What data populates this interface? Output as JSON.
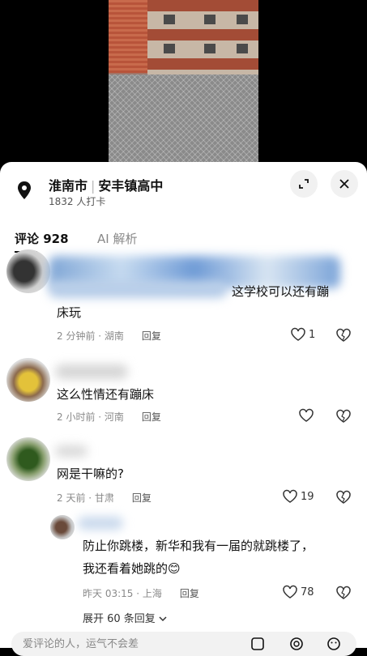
{
  "location": {
    "city": "淮南市",
    "place": "安丰镇高中",
    "checkins": "1832 人打卡"
  },
  "tabs": [
    {
      "label": "评论 928",
      "active": true
    },
    {
      "label": "AI 解析",
      "active": false
    }
  ],
  "comments": [
    {
      "text_line1": "这学校可以还有蹦",
      "text_line2": "床玩",
      "time_region": "2 分钟前 · 湖南",
      "reply_label": "回复",
      "likes": "1"
    },
    {
      "text_line1": "这么性情还有蹦床",
      "time_region": "2 小时前 · 河南",
      "reply_label": "回复",
      "likes": ""
    },
    {
      "text_line1": "网是干嘛的?",
      "time_region": "2 天前 · 甘肃",
      "reply_label": "回复",
      "likes": "19"
    }
  ],
  "reply": {
    "text_line1": "防止你跳楼，新华和我有一届的就跳楼了，",
    "text_line2": "我还看着她跳的",
    "emoji": "😊",
    "time_region": "昨天 03:15 · 上海",
    "reply_label": "回复",
    "likes": "78",
    "expand_label": "展开 60 条回复"
  },
  "input": {
    "placeholder": "爱评论的人，运气不会差"
  },
  "icons": [
    "location-icon",
    "expand-icon",
    "close-icon",
    "heart-icon",
    "broken-heart-icon",
    "chevron-down-icon",
    "image-icon",
    "at-icon",
    "emoji-icon"
  ]
}
